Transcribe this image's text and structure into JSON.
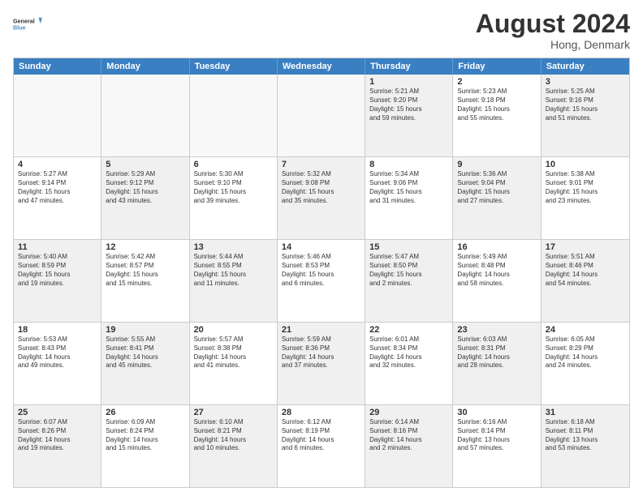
{
  "logo": {
    "text_general": "General",
    "text_blue": "Blue"
  },
  "header": {
    "month_year": "August 2024",
    "location": "Hong, Denmark"
  },
  "days_of_week": [
    "Sunday",
    "Monday",
    "Tuesday",
    "Wednesday",
    "Thursday",
    "Friday",
    "Saturday"
  ],
  "rows": [
    [
      {
        "day": "",
        "text": "",
        "empty": true
      },
      {
        "day": "",
        "text": "",
        "empty": true
      },
      {
        "day": "",
        "text": "",
        "empty": true
      },
      {
        "day": "",
        "text": "",
        "empty": true
      },
      {
        "day": "1",
        "text": "Sunrise: 5:21 AM\nSunset: 9:20 PM\nDaylight: 15 hours\nand 59 minutes.",
        "shaded": true
      },
      {
        "day": "2",
        "text": "Sunrise: 5:23 AM\nSunset: 9:18 PM\nDaylight: 15 hours\nand 55 minutes.",
        "shaded": false
      },
      {
        "day": "3",
        "text": "Sunrise: 5:25 AM\nSunset: 9:16 PM\nDaylight: 15 hours\nand 51 minutes.",
        "shaded": true
      }
    ],
    [
      {
        "day": "4",
        "text": "Sunrise: 5:27 AM\nSunset: 9:14 PM\nDaylight: 15 hours\nand 47 minutes.",
        "shaded": false
      },
      {
        "day": "5",
        "text": "Sunrise: 5:29 AM\nSunset: 9:12 PM\nDaylight: 15 hours\nand 43 minutes.",
        "shaded": true
      },
      {
        "day": "6",
        "text": "Sunrise: 5:30 AM\nSunset: 9:10 PM\nDaylight: 15 hours\nand 39 minutes.",
        "shaded": false
      },
      {
        "day": "7",
        "text": "Sunrise: 5:32 AM\nSunset: 9:08 PM\nDaylight: 15 hours\nand 35 minutes.",
        "shaded": true
      },
      {
        "day": "8",
        "text": "Sunrise: 5:34 AM\nSunset: 9:06 PM\nDaylight: 15 hours\nand 31 minutes.",
        "shaded": false
      },
      {
        "day": "9",
        "text": "Sunrise: 5:36 AM\nSunset: 9:04 PM\nDaylight: 15 hours\nand 27 minutes.",
        "shaded": true
      },
      {
        "day": "10",
        "text": "Sunrise: 5:38 AM\nSunset: 9:01 PM\nDaylight: 15 hours\nand 23 minutes.",
        "shaded": false
      }
    ],
    [
      {
        "day": "11",
        "text": "Sunrise: 5:40 AM\nSunset: 8:59 PM\nDaylight: 15 hours\nand 19 minutes.",
        "shaded": true
      },
      {
        "day": "12",
        "text": "Sunrise: 5:42 AM\nSunset: 8:57 PM\nDaylight: 15 hours\nand 15 minutes.",
        "shaded": false
      },
      {
        "day": "13",
        "text": "Sunrise: 5:44 AM\nSunset: 8:55 PM\nDaylight: 15 hours\nand 11 minutes.",
        "shaded": true
      },
      {
        "day": "14",
        "text": "Sunrise: 5:46 AM\nSunset: 8:53 PM\nDaylight: 15 hours\nand 6 minutes.",
        "shaded": false
      },
      {
        "day": "15",
        "text": "Sunrise: 5:47 AM\nSunset: 8:50 PM\nDaylight: 15 hours\nand 2 minutes.",
        "shaded": true
      },
      {
        "day": "16",
        "text": "Sunrise: 5:49 AM\nSunset: 8:48 PM\nDaylight: 14 hours\nand 58 minutes.",
        "shaded": false
      },
      {
        "day": "17",
        "text": "Sunrise: 5:51 AM\nSunset: 8:46 PM\nDaylight: 14 hours\nand 54 minutes.",
        "shaded": true
      }
    ],
    [
      {
        "day": "18",
        "text": "Sunrise: 5:53 AM\nSunset: 8:43 PM\nDaylight: 14 hours\nand 49 minutes.",
        "shaded": false
      },
      {
        "day": "19",
        "text": "Sunrise: 5:55 AM\nSunset: 8:41 PM\nDaylight: 14 hours\nand 45 minutes.",
        "shaded": true
      },
      {
        "day": "20",
        "text": "Sunrise: 5:57 AM\nSunset: 8:38 PM\nDaylight: 14 hours\nand 41 minutes.",
        "shaded": false
      },
      {
        "day": "21",
        "text": "Sunrise: 5:59 AM\nSunset: 8:36 PM\nDaylight: 14 hours\nand 37 minutes.",
        "shaded": true
      },
      {
        "day": "22",
        "text": "Sunrise: 6:01 AM\nSunset: 8:34 PM\nDaylight: 14 hours\nand 32 minutes.",
        "shaded": false
      },
      {
        "day": "23",
        "text": "Sunrise: 6:03 AM\nSunset: 8:31 PM\nDaylight: 14 hours\nand 28 minutes.",
        "shaded": true
      },
      {
        "day": "24",
        "text": "Sunrise: 6:05 AM\nSunset: 8:29 PM\nDaylight: 14 hours\nand 24 minutes.",
        "shaded": false
      }
    ],
    [
      {
        "day": "25",
        "text": "Sunrise: 6:07 AM\nSunset: 8:26 PM\nDaylight: 14 hours\nand 19 minutes.",
        "shaded": true
      },
      {
        "day": "26",
        "text": "Sunrise: 6:09 AM\nSunset: 8:24 PM\nDaylight: 14 hours\nand 15 minutes.",
        "shaded": false
      },
      {
        "day": "27",
        "text": "Sunrise: 6:10 AM\nSunset: 8:21 PM\nDaylight: 14 hours\nand 10 minutes.",
        "shaded": true
      },
      {
        "day": "28",
        "text": "Sunrise: 6:12 AM\nSunset: 8:19 PM\nDaylight: 14 hours\nand 6 minutes.",
        "shaded": false
      },
      {
        "day": "29",
        "text": "Sunrise: 6:14 AM\nSunset: 8:16 PM\nDaylight: 14 hours\nand 2 minutes.",
        "shaded": true
      },
      {
        "day": "30",
        "text": "Sunrise: 6:16 AM\nSunset: 8:14 PM\nDaylight: 13 hours\nand 57 minutes.",
        "shaded": false
      },
      {
        "day": "31",
        "text": "Sunrise: 6:18 AM\nSunset: 8:11 PM\nDaylight: 13 hours\nand 53 minutes.",
        "shaded": true
      }
    ]
  ]
}
